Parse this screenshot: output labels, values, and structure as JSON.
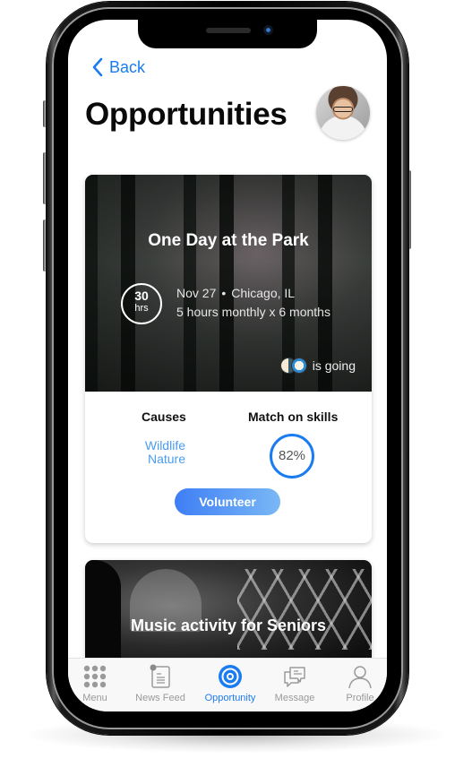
{
  "nav": {
    "back_label": "Back"
  },
  "header": {
    "title": "Opportunities"
  },
  "opportunities": [
    {
      "title": "One Day at the Park",
      "hours_value": "30",
      "hours_unit": "hrs",
      "date": "Nov 27",
      "separator": "•",
      "location": "Chicago, IL",
      "schedule": "5 hours monthly x 6 months",
      "going_label": "is going",
      "causes_heading": "Causes",
      "causes": [
        "Wildlife",
        "Nature"
      ],
      "match_heading": "Match on skills",
      "match_percent_label": "82%",
      "match_percent": 82,
      "cta_label": "Volunteer"
    },
    {
      "title": "Music activity for Seniors"
    }
  ],
  "tabbar": {
    "items": [
      {
        "label": "Menu",
        "icon": "grid-icon",
        "active": false
      },
      {
        "label": "News Feed",
        "icon": "news-feed-icon",
        "active": false
      },
      {
        "label": "Opportunity",
        "icon": "target-icon",
        "active": true
      },
      {
        "label": "Message",
        "icon": "chat-bubbles-icon",
        "active": false
      },
      {
        "label": "Profile",
        "icon": "person-icon",
        "active": false
      }
    ]
  },
  "colors": {
    "accent": "#1a7cf0",
    "cause_link": "#4a9cf2",
    "button_gradient_start": "#3e7ef5",
    "button_gradient_end": "#7ab8f5",
    "tab_inactive": "#9a9a9a"
  }
}
